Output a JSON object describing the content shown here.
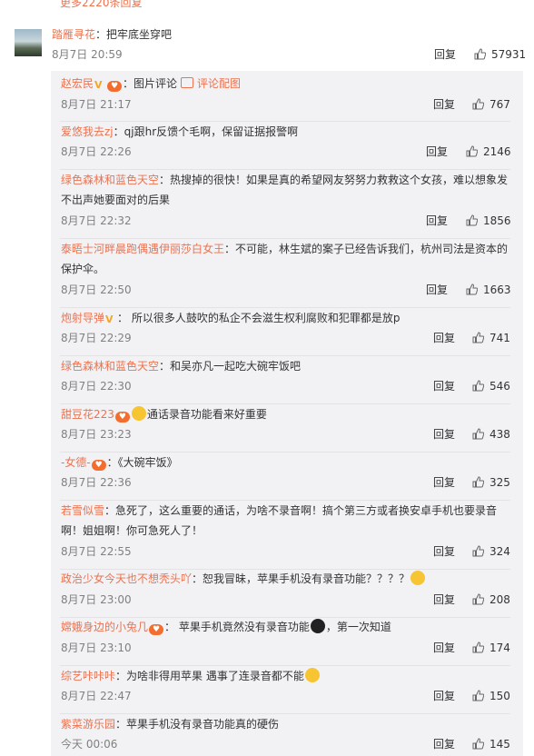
{
  "top_fragment": "更多2220条回复",
  "top_comment": {
    "user": "踏雁寻花",
    "text": "：把牢底坐穿吧",
    "time": "8月7日 20:59",
    "reply": "回复",
    "likes": "57931"
  },
  "replies": [
    {
      "user": "赵宏民",
      "text": "：图片评论",
      "extra": "评论配图",
      "time": "8月7日 21:17",
      "reply": "回复",
      "likes": "767"
    },
    {
      "user": "爱悠我去zj",
      "text": "：qj跟hr反馈个毛啊，保留证据报警啊",
      "time": "8月7日 22:26",
      "reply": "回复",
      "likes": "2146"
    },
    {
      "user": "绿色森林和蓝色天空",
      "text": "：热搜掉的很快！如果是真的希望网友努努力救救这个女孩，难以想象发",
      "text2": "不出声她要面对的后果",
      "time": "8月7日 22:32",
      "reply": "回复",
      "likes": "1856"
    },
    {
      "user": "泰晤士河畔晨跑偶遇伊丽莎白女王",
      "text": "：不可能，林生斌的案子已经告诉我们，杭州司法是资本的",
      "text2": "保护伞。",
      "time": "8月7日 22:50",
      "reply": "回复",
      "likes": "1663"
    },
    {
      "user": "炮射导弹",
      "text": "： 所以很多人鼓吹的私企不会滋生权利腐败和犯罪都是放p",
      "time": "8月7日 22:29",
      "reply": "回复",
      "likes": "741"
    },
    {
      "user": "绿色森林和蓝色天空",
      "text": "：和吴亦凡一起吃大碗牢饭吧",
      "time": "8月7日 22:30",
      "reply": "回复",
      "likes": "546"
    },
    {
      "user": "甜豆花223",
      "text": "通话录音功能看来好重要",
      "time": "8月7日 23:23",
      "reply": "回复",
      "likes": "438"
    },
    {
      "user": "-女德-",
      "text": "：《大碗牢饭》",
      "time": "8月7日 22:36",
      "reply": "回复",
      "likes": "325"
    },
    {
      "user": "若雪似雪",
      "text": "：急死了，这么重要的通话，为啥不录音啊！搞个第三方或者换安卓手机也要录音",
      "text2": "啊！姐姐啊！你可急死人了！",
      "time": "8月7日 22:55",
      "reply": "回复",
      "likes": "324"
    },
    {
      "user": "政治少女今天也不想秃头吖",
      "text": "：恕我冒昧，苹果手机没有录音功能？？？？",
      "time": "8月7日 23:00",
      "reply": "回复",
      "likes": "208"
    },
    {
      "user": "嫦娥身边的小兔几",
      "text": "： 苹果手机竟然没有录音功能",
      "text_after": "，第一次知道",
      "time": "8月7日 23:10",
      "reply": "回复",
      "likes": "174"
    },
    {
      "user": "综艺咔咔咔",
      "text": "：为啥非得用苹果  遇事了连录音都不能",
      "time": "8月7日 22:47",
      "reply": "回复",
      "likes": "150"
    },
    {
      "user": "紫菜游乐园",
      "text": "：苹果手机没有录音功能真的硬伤",
      "time": "今天 00:06",
      "reply": "回复",
      "likes": "145"
    }
  ],
  "colors": {
    "username": "#eb7350",
    "text": "#333333",
    "meta": "#808080",
    "panel": "#f2f2f5"
  }
}
